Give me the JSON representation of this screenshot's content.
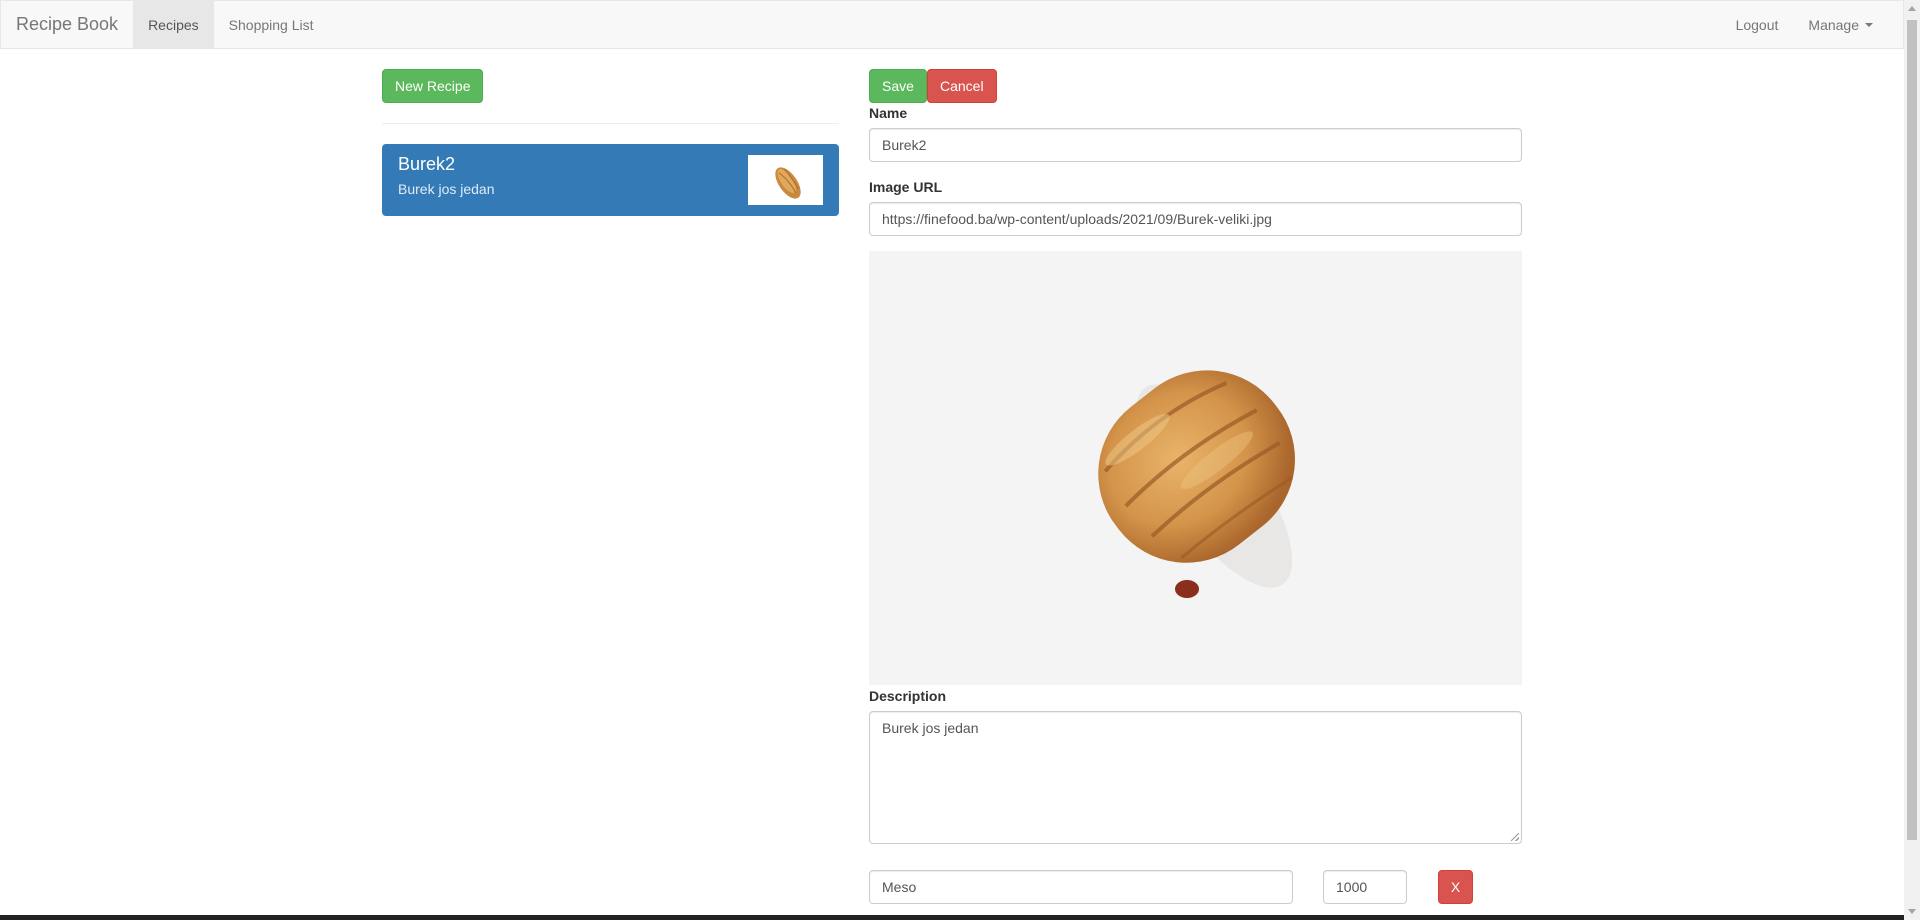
{
  "navbar": {
    "brand": "Recipe Book",
    "links": [
      "Recipes",
      "Shopping List"
    ],
    "active_link": "Recipes",
    "right": {
      "logout": "Logout",
      "manage": "Manage"
    }
  },
  "recipe_list": {
    "new_button": "New Recipe",
    "items": [
      {
        "name": "Burek2",
        "description": "Burek jos jedan"
      }
    ]
  },
  "edit_form": {
    "save_label": "Save",
    "cancel_label": "Cancel",
    "name_label": "Name",
    "name_value": "Burek2",
    "image_url_label": "Image URL",
    "image_url_value": "https://finefood.ba/wp-content/uploads/2021/09/Burek-veliki.jpg",
    "description_label": "Description",
    "description_value": "Burek jos jedan",
    "ingredients": [
      {
        "name": "Meso",
        "amount": "1000",
        "remove_label": "X"
      }
    ]
  },
  "colors": {
    "primary": "#337ab7",
    "success": "#5cb85c",
    "danger": "#d9534f",
    "navbar_bg": "#f8f8f8"
  }
}
